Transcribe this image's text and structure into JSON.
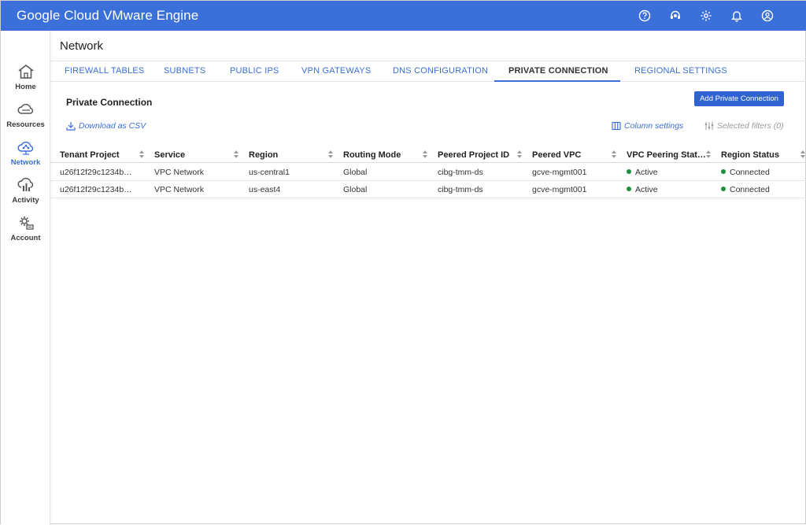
{
  "app": {
    "title": "Google Cloud VMware Engine"
  },
  "topbar_icons": [
    "help-icon",
    "support-icon",
    "settings-icon",
    "notifications-icon",
    "account-icon"
  ],
  "leftnav": [
    {
      "label": "Home",
      "icon": "home-icon",
      "active": false
    },
    {
      "label": "Resources",
      "icon": "cloud-icon",
      "active": false
    },
    {
      "label": "Network",
      "icon": "network-cloud-icon",
      "active": true
    },
    {
      "label": "Activity",
      "icon": "activity-icon",
      "active": false
    },
    {
      "label": "Account",
      "icon": "account-gear-icon",
      "active": false
    }
  ],
  "page": {
    "title": "Network"
  },
  "tabs": [
    {
      "label": "FIREWALL TABLES"
    },
    {
      "label": "SUBNETS"
    },
    {
      "label": "PUBLIC IPS"
    },
    {
      "label": "VPN GATEWAYS"
    },
    {
      "label": "DNS CONFIGURATION"
    },
    {
      "label": "PRIVATE CONNECTION",
      "active": true
    },
    {
      "label": "REGIONAL SETTINGS"
    }
  ],
  "section": {
    "title": "Private Connection",
    "add_button": "Add Private Connection",
    "download_csv": "Download as CSV",
    "column_settings": "Column settings",
    "selected_filters": "Selected filters (0)"
  },
  "table": {
    "columns": [
      "Tenant Project",
      "Service",
      "Region",
      "Routing Mode",
      "Peered Project ID",
      "Peered VPC",
      "VPC Peering Stat…",
      "Region Status"
    ],
    "rows": [
      [
        "u26f12f29c1234b…",
        "VPC Network",
        "us-central1",
        "Global",
        "cibg-tmm-ds",
        "gcve-mgmt001",
        "Active",
        "Connected"
      ],
      [
        "u26f12f29c1234b…",
        "VPC Network",
        "us-east4",
        "Global",
        "cibg-tmm-ds",
        "gcve-mgmt001",
        "Active",
        "Connected"
      ]
    ]
  },
  "colors": {
    "brand": "#3b6fd9",
    "status_ok": "#1e8e3e"
  }
}
